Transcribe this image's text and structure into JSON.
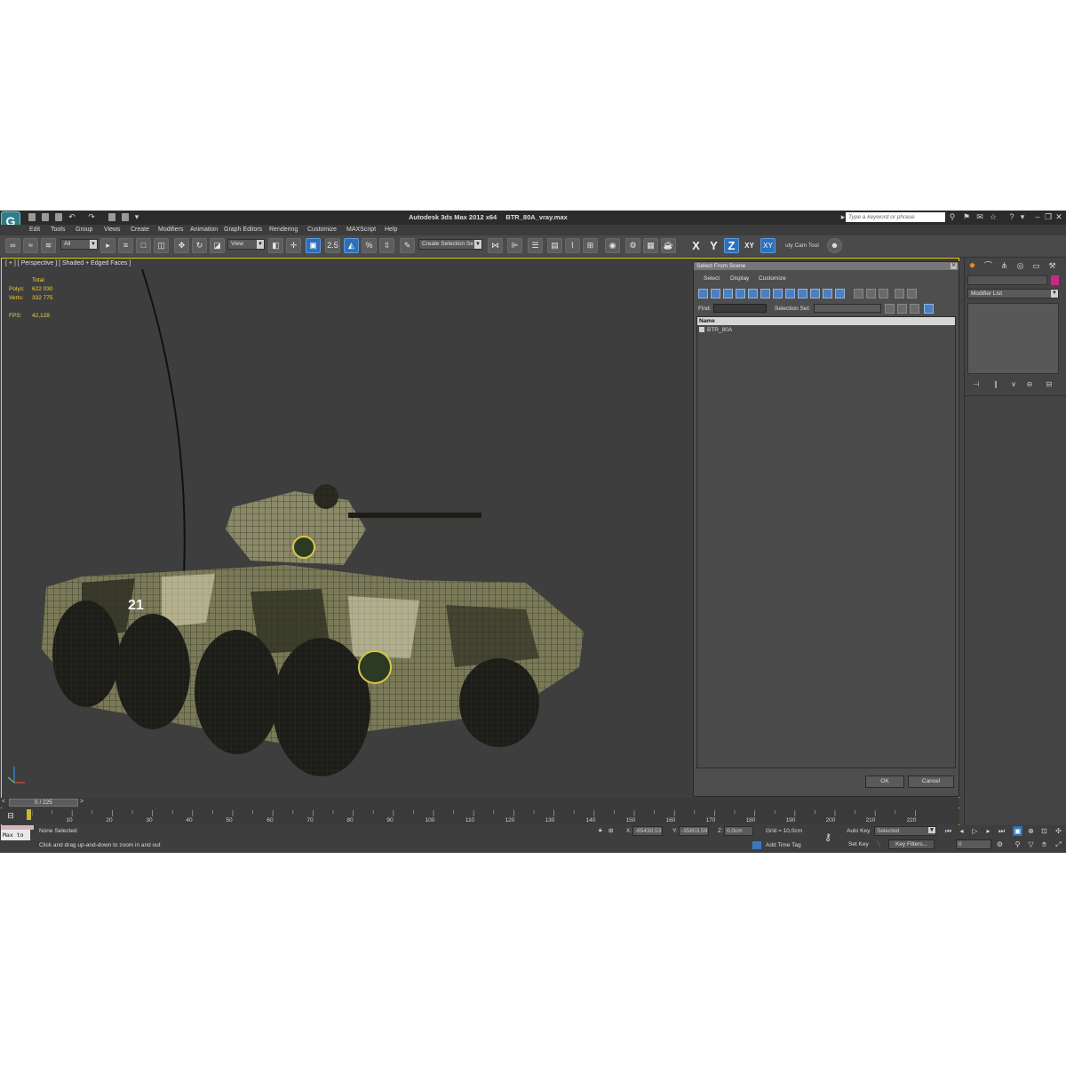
{
  "app": {
    "title": "Autodesk 3ds Max  2012 x64",
    "filename": "BTR_80A_vray.max",
    "logo": "3ds-max-logo",
    "search_placeholder": "Type a keyword or phrase"
  },
  "menu": [
    "Edit",
    "Tools",
    "Group",
    "Views",
    "Create",
    "Modifiers",
    "Animation",
    "Graph Editors",
    "Rendering",
    "Customize",
    "MAXScript",
    "Help"
  ],
  "toolbar": {
    "selection_filter": "All",
    "reference_coord": "View",
    "snap_label": "2.5",
    "named_selection": "Create Selection Se",
    "axis_x": "X",
    "axis_y": "Y",
    "axis_z": "Z",
    "axis_xy": "XY",
    "axis_xy2": "XY",
    "cam_tool": "uty Cam Tool",
    "active_axis": "Z"
  },
  "viewport": {
    "label": "[ + ] [ Perspective ] [ Shaded + Edged Faces ]",
    "stats_header": "Total",
    "stats": [
      {
        "key": "Polys:",
        "value": "622 030"
      },
      {
        "key": "Verts:",
        "value": "332 775"
      }
    ],
    "fps_key": "FPS:",
    "fps_value": "42,128",
    "stats_color": "#f0d23a",
    "border_color": "#f5d300",
    "vehicle_number": "21"
  },
  "dialog": {
    "title": "Select From Scene",
    "menus": [
      "Select",
      "Display",
      "Customize"
    ],
    "find_label": "Find:",
    "selection_set_label": "Selection Set:",
    "column_name": "Name",
    "objects": [
      "BTR_80A"
    ],
    "ok": "OK",
    "cancel": "Cancel"
  },
  "command_panel": {
    "modifier_list": "Modifier List",
    "object_color": "#c8288a"
  },
  "timeline": {
    "frame_display": "0 / 225",
    "ticks": [
      "10",
      "20",
      "30",
      "40",
      "50",
      "60",
      "70",
      "80",
      "90",
      "100",
      "110",
      "120",
      "130",
      "140",
      "150",
      "160",
      "170",
      "180",
      "190",
      "200",
      "210",
      "220"
    ]
  },
  "status": {
    "maxscript": "Max to",
    "selection": "None Selected",
    "prompt": "Click and drag up-and-down to zoom in and out",
    "x_label": "X:",
    "x_value": "-65430,53",
    "y_label": "Y:",
    "y_value": "-35803,59",
    "z_label": "Z:",
    "z_value": "0,0cm",
    "grid": "Grid = 10,0cm",
    "add_time_tag": "Add Time Tag",
    "auto_key": "Auto Key",
    "set_key": "Set Key",
    "key_mode": "Selected",
    "key_filters": "Key Filters...",
    "frame_value": "0"
  }
}
